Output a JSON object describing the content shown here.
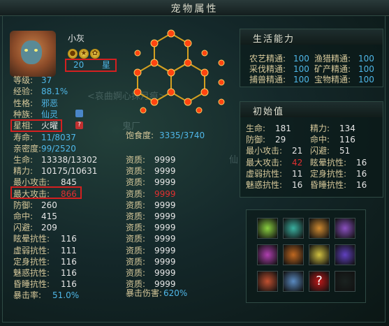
{
  "window": {
    "title": "宠物属性"
  },
  "pet": {
    "name": "小灰",
    "star_count": "20",
    "star_unit": "星",
    "left_stats": [
      {
        "label": "等级:",
        "value": "37",
        "color": "#4fb7e8"
      },
      {
        "label": "经验:",
        "value": "88.1%",
        "color": "#4fb7e8"
      },
      {
        "label": "性格:",
        "value": "邪恶",
        "color": "#4fb7e8"
      },
      {
        "label": "种族:",
        "value": "仙灵",
        "color": "#4fb7e8"
      },
      {
        "label": "星相:",
        "value": "火曜",
        "color": "#e6e6e6"
      },
      {
        "label": "寿命:",
        "value": "11/8037",
        "color": "#4fb7e8"
      },
      {
        "label": "亲密度:",
        "value": "99/2520",
        "color": "#4fb7e8"
      }
    ],
    "attrs": [
      {
        "label": "生命:",
        "value": "13338/13302",
        "color": "#e6e6e6"
      },
      {
        "label": "精力:",
        "value": "10175/10631",
        "color": "#e6e6e6"
      },
      {
        "label": "最小攻击:",
        "value": "845",
        "color": "#e6e6e6"
      },
      {
        "label": "最大攻击:",
        "value": "866",
        "color": "#e03030"
      },
      {
        "label": "防御:",
        "value": "260",
        "color": "#e6e6e6"
      },
      {
        "label": "命中:",
        "value": "415",
        "color": "#e6e6e6"
      },
      {
        "label": "闪避:",
        "value": "209",
        "color": "#e6e6e6"
      },
      {
        "label": "眩晕抗性:",
        "value": "116",
        "color": "#e6e6e6"
      },
      {
        "label": "虚弱抗性:",
        "value": "111",
        "color": "#e6e6e6"
      },
      {
        "label": "定身抗性:",
        "value": "116",
        "color": "#e6e6e6"
      },
      {
        "label": "魅惑抗性:",
        "value": "116",
        "color": "#e6e6e6"
      },
      {
        "label": "昏睡抗性:",
        "value": "116",
        "color": "#e6e6e6"
      },
      {
        "label": "暴击率:",
        "value": "51.0%",
        "color": "#4fb7e8"
      }
    ],
    "satiety_label": "饱食度:",
    "satiety_value": "3335/3740",
    "aptitudes": [
      {
        "label": "资质:",
        "value": "9999",
        "color": "#e6e6e6"
      },
      {
        "label": "资质:",
        "value": "9999",
        "color": "#e6e6e6"
      },
      {
        "label": "资质:",
        "value": "9999",
        "color": "#e6e6e6"
      },
      {
        "label": "资质:",
        "value": "9999",
        "color": "#e03030"
      },
      {
        "label": "资质:",
        "value": "9999",
        "color": "#e6e6e6"
      },
      {
        "label": "资质:",
        "value": "9999",
        "color": "#e6e6e6"
      },
      {
        "label": "资质:",
        "value": "9999",
        "color": "#e6e6e6"
      },
      {
        "label": "资质:",
        "value": "9999",
        "color": "#e6e6e6"
      },
      {
        "label": "资质:",
        "value": "9999",
        "color": "#e6e6e6"
      },
      {
        "label": "资质:",
        "value": "9999",
        "color": "#e6e6e6"
      },
      {
        "label": "资质:",
        "value": "9999",
        "color": "#e6e6e6"
      },
      {
        "label": "资质:",
        "value": "9999",
        "color": "#e6e6e6"
      }
    ],
    "crit_damage_label": "暴击伤害:",
    "crit_damage_value": "620%"
  },
  "life_skills": {
    "title": "生活能力",
    "rows": [
      [
        {
          "label": "农艺精通:",
          "value": "100"
        },
        {
          "label": "渔猎精通:",
          "value": "100"
        }
      ],
      [
        {
          "label": "采伐精通:",
          "value": "100"
        },
        {
          "label": "矿产精通:",
          "value": "100"
        }
      ],
      [
        {
          "label": "捕兽精通:",
          "value": "100"
        },
        {
          "label": "宝物精通:",
          "value": "100"
        }
      ]
    ]
  },
  "initial": {
    "title": "初始值",
    "rows": [
      [
        {
          "label": "生命:",
          "value": "181",
          "color": "#e6e6e6"
        },
        {
          "label": "精力:",
          "value": "134",
          "color": "#e6e6e6"
        }
      ],
      [
        {
          "label": "防御:",
          "value": "29",
          "color": "#e6e6e6"
        },
        {
          "label": "命中:",
          "value": "116",
          "color": "#e6e6e6"
        }
      ],
      [
        {
          "label": "最小攻击:",
          "value": "21",
          "color": "#e6e6e6"
        },
        {
          "label": "闪避:",
          "value": "51",
          "color": "#e6e6e6"
        }
      ],
      [
        {
          "label": "最大攻击:",
          "value": "42",
          "color": "#e03030"
        },
        {
          "label": "眩晕抗性:",
          "value": "16",
          "color": "#e6e6e6"
        }
      ],
      [
        {
          "label": "虚弱抗性:",
          "value": "11",
          "color": "#e6e6e6"
        },
        {
          "label": "定身抗性:",
          "value": "16",
          "color": "#e6e6e6"
        }
      ],
      [
        {
          "label": "魅惑抗性:",
          "value": "16",
          "color": "#e6e6e6"
        },
        {
          "label": "昏睡抗性:",
          "value": "16",
          "color": "#e6e6e6"
        }
      ]
    ]
  },
  "background_text": [
    "<哀曲婀心抹月痕>",
    "鬼厂",
    "仙"
  ],
  "skills": [
    {
      "icon": "lightning-skill-icon",
      "color": "#8ad040"
    },
    {
      "icon": "vortex-skill-icon",
      "color": "#3ab0a0"
    },
    {
      "icon": "flame-pillar-skill-icon",
      "color": "#d08a30"
    },
    {
      "icon": "arcane-slash-skill-icon",
      "color": "#8a50c0"
    },
    {
      "icon": "spiral-skill-icon",
      "color": "#b040b0"
    },
    {
      "icon": "fire-burst-skill-icon",
      "color": "#c06820"
    },
    {
      "icon": "holy-light-skill-icon",
      "color": "#d0c040"
    },
    {
      "icon": "storm-skill-icon",
      "color": "#6040c0"
    },
    {
      "icon": "crescent-skill-icon",
      "color": "#c05030"
    },
    {
      "icon": "cross-slash-skill-icon",
      "color": "#5a8ac0"
    },
    {
      "icon": "unknown-skill-icon",
      "color": "#c01818"
    },
    {
      "icon": "empty-slot",
      "color": "#1a2220"
    }
  ]
}
